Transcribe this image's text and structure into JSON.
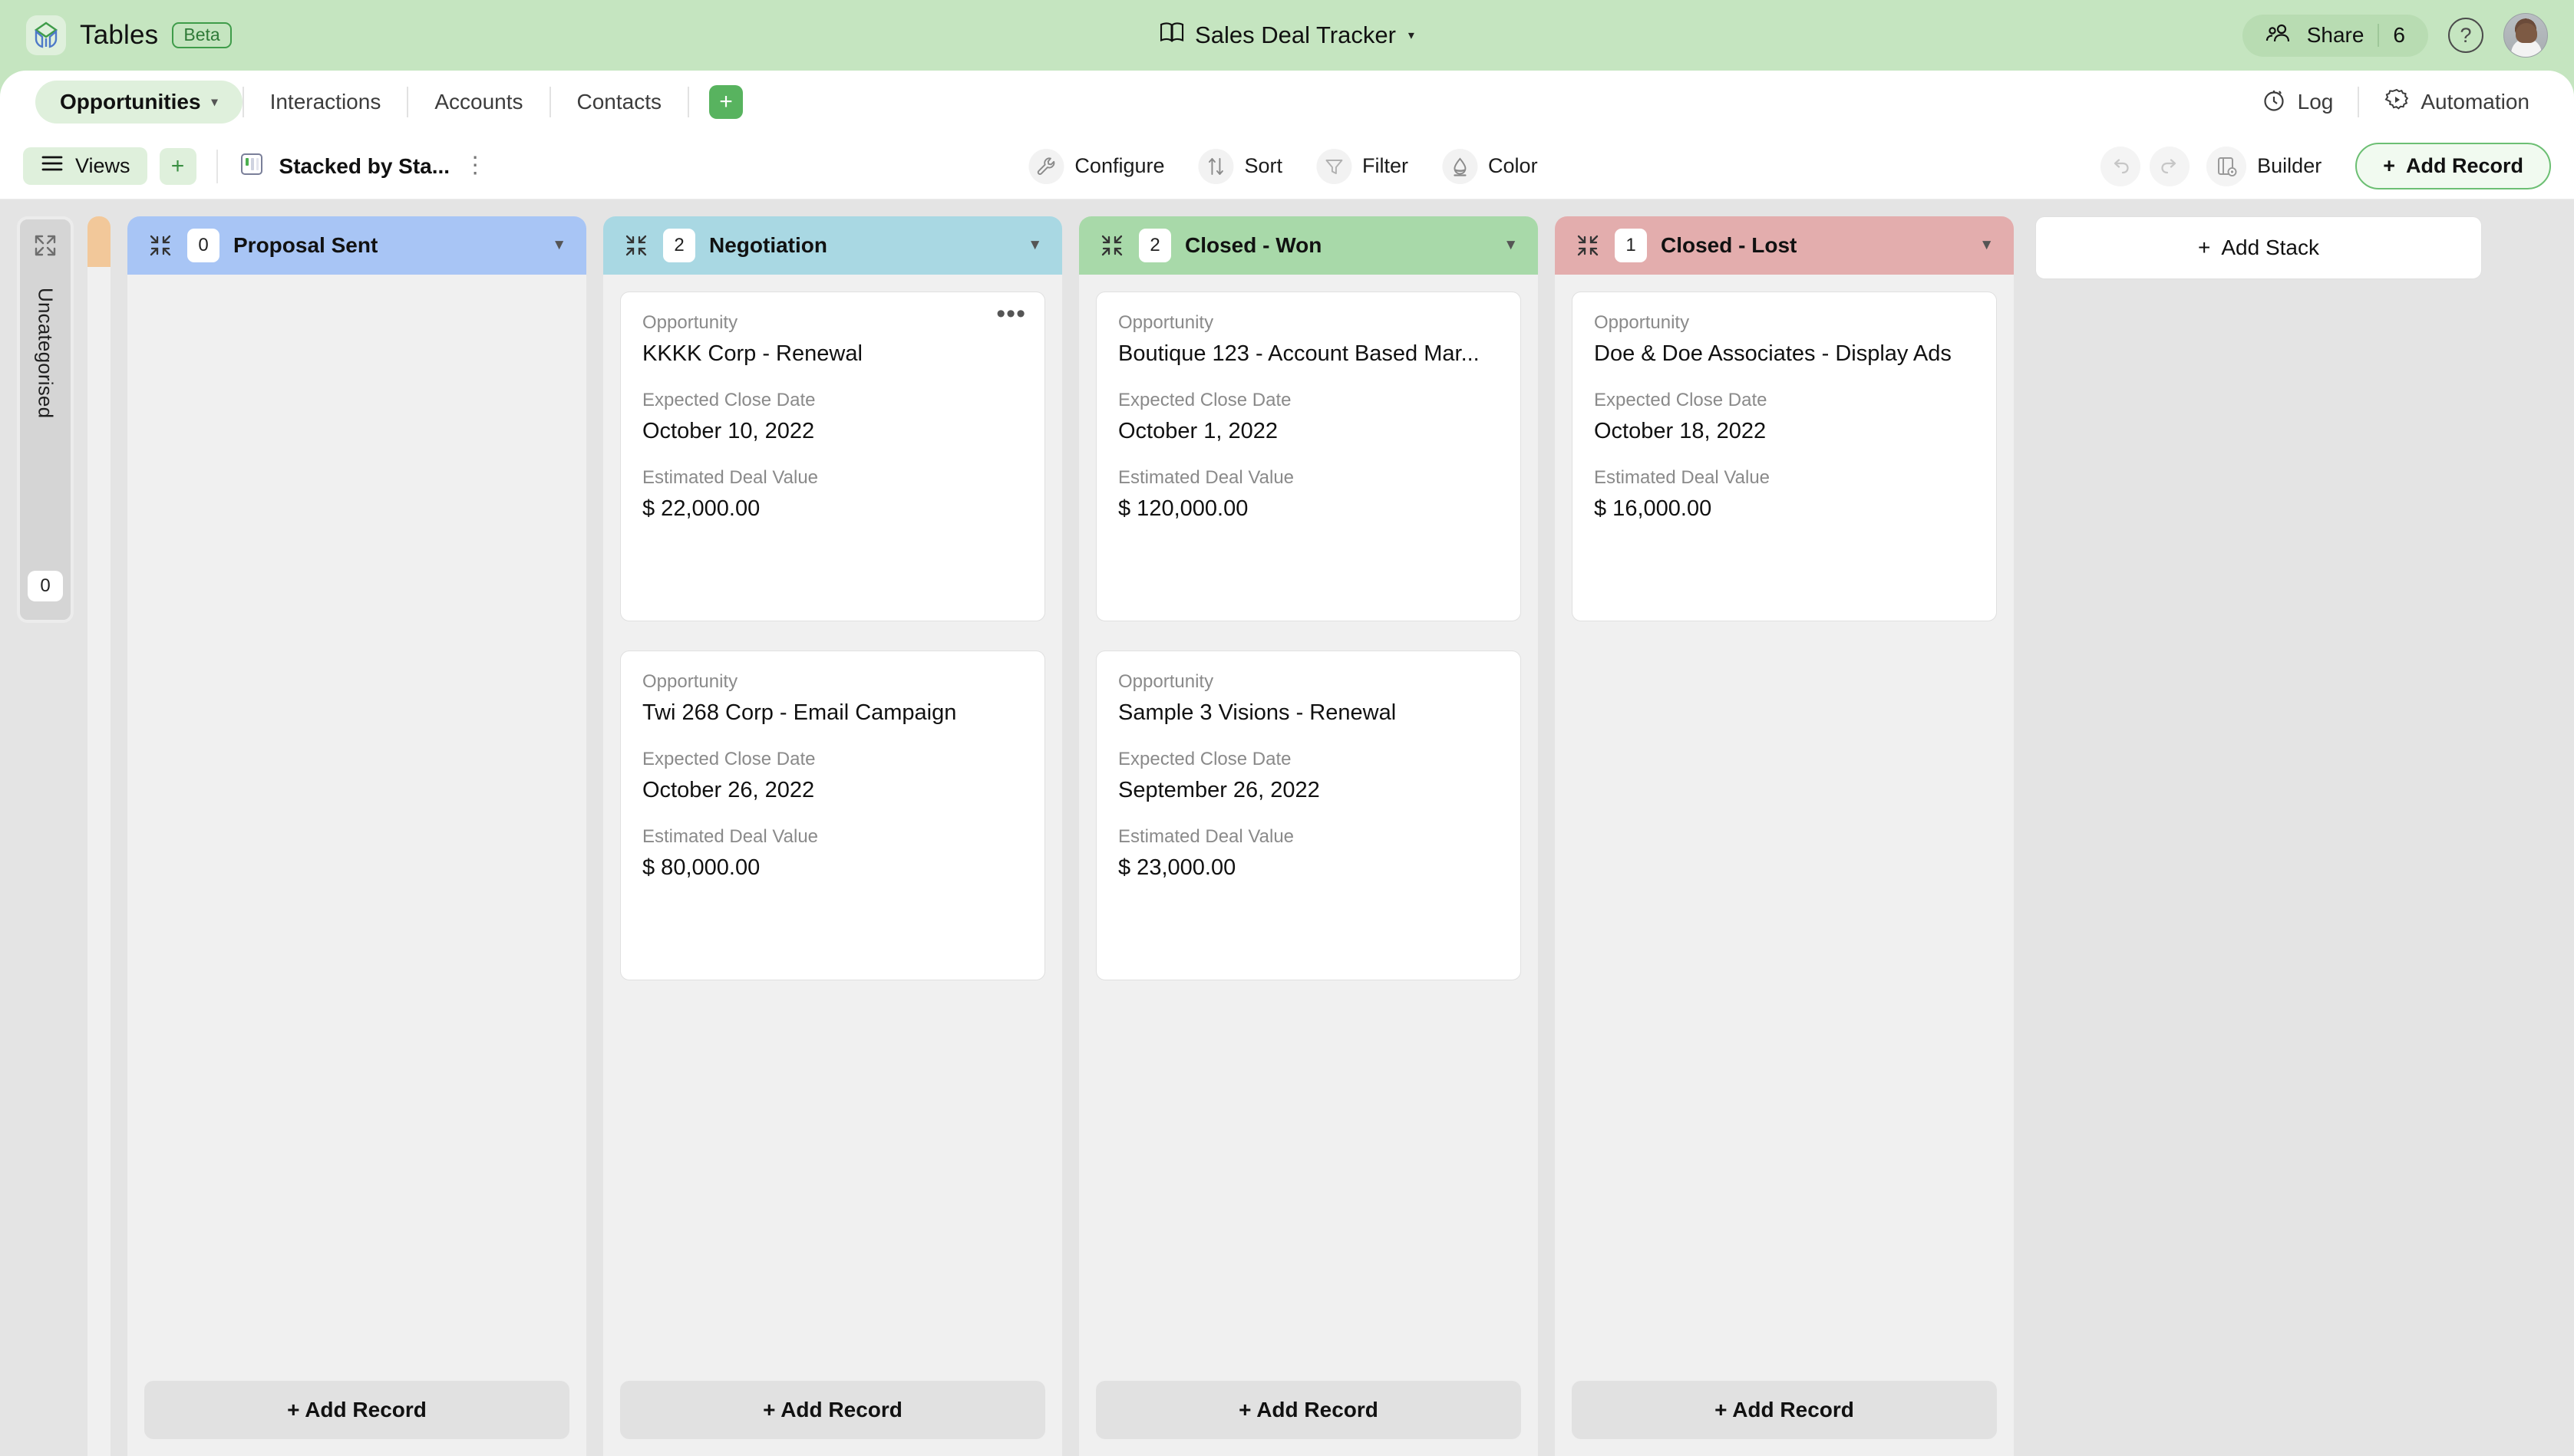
{
  "header": {
    "brand": "Tables",
    "beta": "Beta",
    "doc_title": "Sales Deal Tracker",
    "share_label": "Share",
    "share_count": "6",
    "icons": {
      "logo": "tables-logo-icon",
      "book": "open-book-icon",
      "caret": "▾",
      "help": "?"
    }
  },
  "tabs": {
    "items": [
      {
        "label": "Opportunities",
        "active": true
      },
      {
        "label": "Interactions",
        "active": false
      },
      {
        "label": "Accounts",
        "active": false
      },
      {
        "label": "Contacts",
        "active": false
      }
    ],
    "add_label": "+",
    "right": [
      {
        "label": "Log",
        "icon": "stopwatch-icon"
      },
      {
        "label": "Automation",
        "icon": "gear-play-icon"
      }
    ]
  },
  "toolbar": {
    "views_label": "Views",
    "views_add": "+",
    "view_name": "Stacked by Sta...",
    "kebab": "⋮",
    "center": [
      {
        "label": "Configure",
        "icon": "wrench-icon"
      },
      {
        "label": "Sort",
        "icon": "sort-arrows-icon"
      },
      {
        "label": "Filter",
        "icon": "funnel-icon"
      },
      {
        "label": "Color",
        "icon": "paint-drop-icon"
      }
    ],
    "undo": "undo-icon",
    "redo": "redo-icon",
    "builder_label": "Builder",
    "add_record_label": "Add Record",
    "add_record_plus": "+"
  },
  "board": {
    "uncategorised": {
      "label": "Uncategorised",
      "count": "0"
    },
    "add_stack_label": "Add Stack",
    "add_stack_plus": "+",
    "add_record_footer": "+ Add Record",
    "field_labels": {
      "opportunity": "Opportunity",
      "close_date": "Expected Close Date",
      "deal_value": "Estimated Deal Value"
    },
    "stacks": [
      {
        "title": "Proposal Sent",
        "count": "0",
        "color": "#a8c5f5",
        "cards": []
      },
      {
        "title": "Negotiation",
        "count": "2",
        "color": "#a9d8e3",
        "cards": [
          {
            "opportunity": "KKKK Corp - Renewal",
            "close_date": "October 10, 2022",
            "deal_value": "$ 22,000.00",
            "kebab": true
          },
          {
            "opportunity": "Twi 268 Corp - Email Campaign",
            "close_date": "October 26, 2022",
            "deal_value": "$ 80,000.00",
            "kebab": false
          }
        ]
      },
      {
        "title": "Closed - Won",
        "count": "2",
        "color": "#a8d9a9",
        "cards": [
          {
            "opportunity": "Boutique 123 - Account Based Mar...",
            "close_date": "October 1, 2022",
            "deal_value": "$ 120,000.00",
            "kebab": false
          },
          {
            "opportunity": "Sample 3 Visions - Renewal",
            "close_date": "September 26, 2022",
            "deal_value": "$ 23,000.00",
            "kebab": false
          }
        ]
      },
      {
        "title": "Closed - Lost",
        "count": "1",
        "color": "#e3adad",
        "cards": [
          {
            "opportunity": "Doe & Doe Associates - Display Ads",
            "close_date": "October 18, 2022",
            "deal_value": "$ 16,000.00",
            "kebab": false
          }
        ]
      }
    ]
  }
}
